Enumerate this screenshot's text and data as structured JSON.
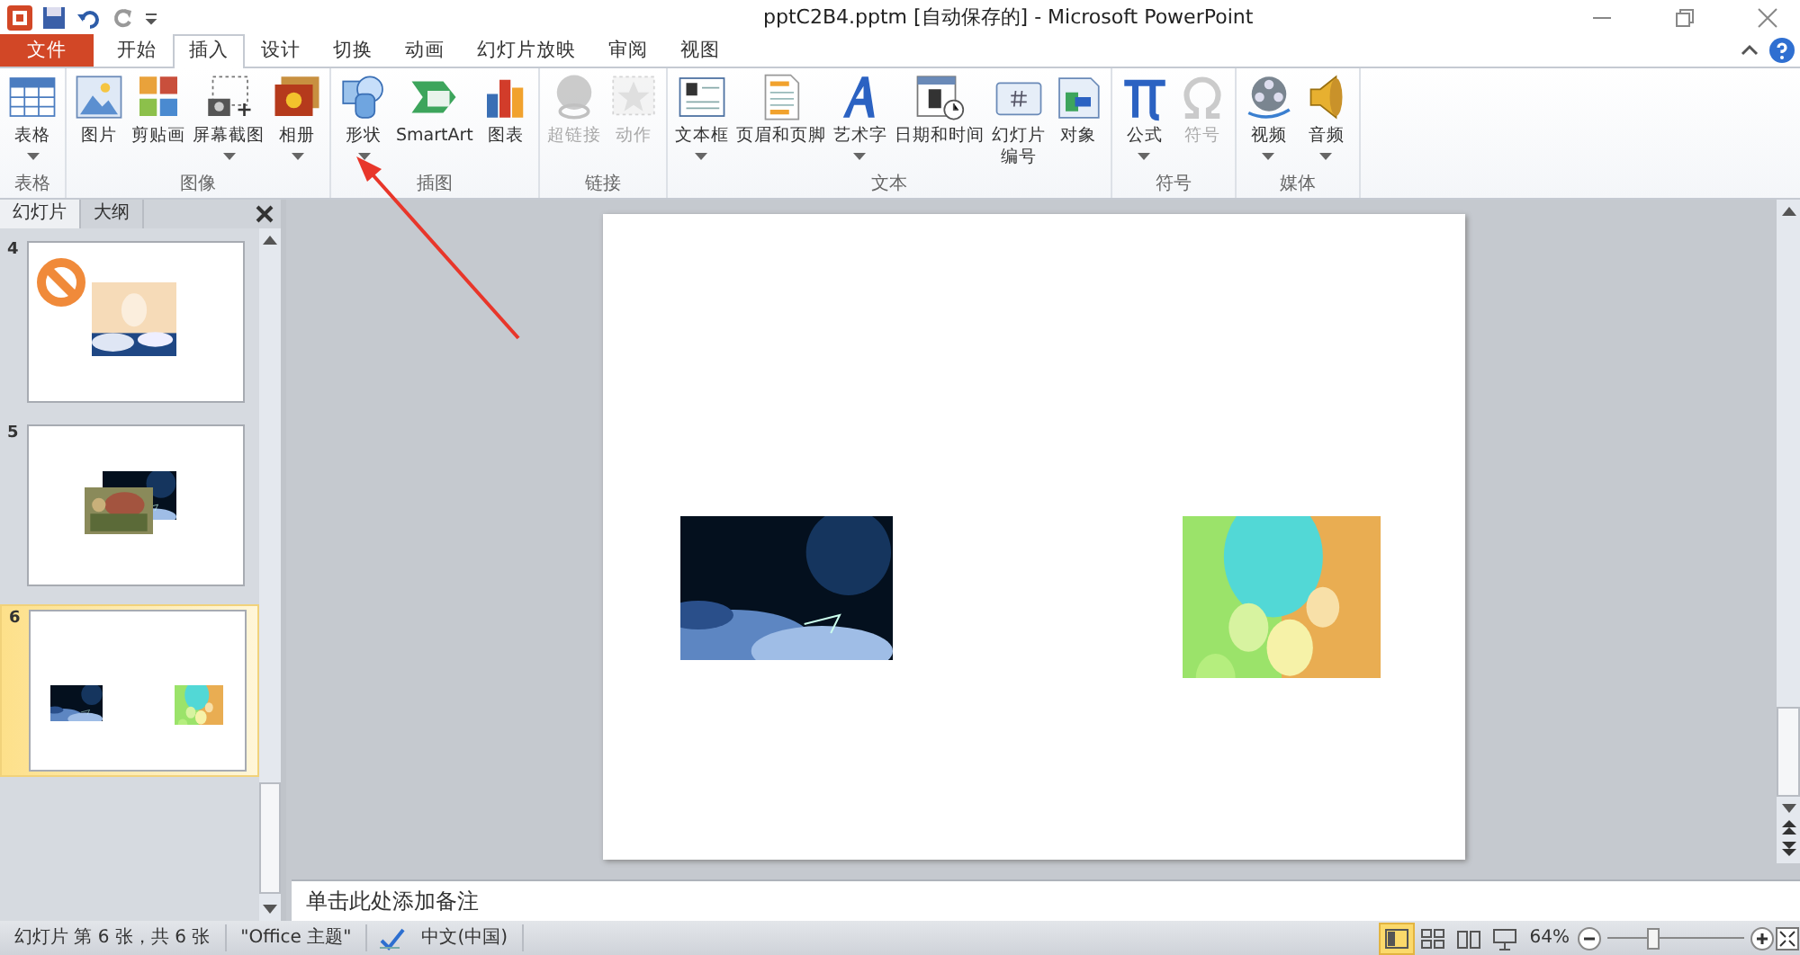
{
  "window": {
    "title": "pptC2B4.pptm [自动保存的] - Microsoft PowerPoint"
  },
  "tabs": [
    {
      "label": "文件",
      "kind": "file",
      "selected": false
    },
    {
      "label": "开始",
      "kind": "tab",
      "selected": false
    },
    {
      "label": "插入",
      "kind": "tab",
      "selected": true
    },
    {
      "label": "设计",
      "kind": "tab",
      "selected": false
    },
    {
      "label": "切换",
      "kind": "tab",
      "selected": false
    },
    {
      "label": "动画",
      "kind": "tab",
      "selected": false
    },
    {
      "label": "幻灯片放映",
      "kind": "tab",
      "selected": false
    },
    {
      "label": "审阅",
      "kind": "tab",
      "selected": false
    },
    {
      "label": "视图",
      "kind": "tab",
      "selected": false
    }
  ],
  "ribbon_groups": [
    {
      "label": "表格",
      "buttons": [
        {
          "label": "表格",
          "kind": "table",
          "dropdown": true,
          "disabled": false
        }
      ]
    },
    {
      "label": "图像",
      "buttons": [
        {
          "label": "图片",
          "kind": "picture",
          "dropdown": false,
          "disabled": false
        },
        {
          "label": "剪贴画",
          "kind": "clipart",
          "dropdown": false,
          "disabled": false
        },
        {
          "label": "屏幕截图",
          "kind": "screenshot",
          "dropdown": true,
          "disabled": false
        },
        {
          "label": "相册",
          "kind": "album",
          "dropdown": true,
          "disabled": false
        }
      ]
    },
    {
      "label": "插图",
      "buttons": [
        {
          "label": "形状",
          "kind": "shapes",
          "dropdown": true,
          "disabled": false
        },
        {
          "label": "SmartArt",
          "kind": "smartart",
          "dropdown": false,
          "disabled": false
        },
        {
          "label": "图表",
          "kind": "chart",
          "dropdown": false,
          "disabled": false
        }
      ]
    },
    {
      "label": "链接",
      "buttons": [
        {
          "label": "超链接",
          "kind": "globe",
          "dropdown": false,
          "disabled": true
        },
        {
          "label": "动作",
          "kind": "star",
          "dropdown": false,
          "disabled": true
        }
      ]
    },
    {
      "label": "文本",
      "buttons": [
        {
          "label": "文本框",
          "kind": "textbox",
          "dropdown": true,
          "disabled": false
        },
        {
          "label": "页眉和页脚",
          "kind": "page",
          "dropdown": false,
          "disabled": false
        },
        {
          "label": "艺术字",
          "kind": "wordart",
          "dropdown": true,
          "disabled": false
        },
        {
          "label": "日期和时间",
          "kind": "calendar",
          "dropdown": false,
          "disabled": false
        },
        {
          "label": "幻灯片编号",
          "kind": "slidenum",
          "dropdown": false,
          "disabled": false
        },
        {
          "label": "对象",
          "kind": "object",
          "dropdown": false,
          "disabled": false
        }
      ]
    },
    {
      "label": "符号",
      "buttons": [
        {
          "label": "公式",
          "kind": "pi",
          "dropdown": true,
          "disabled": false
        },
        {
          "label": "符号",
          "kind": "omega",
          "dropdown": false,
          "disabled": true
        }
      ]
    },
    {
      "label": "媒体",
      "buttons": [
        {
          "label": "视频",
          "kind": "film",
          "dropdown": true,
          "disabled": false
        },
        {
          "label": "音频",
          "kind": "speaker",
          "dropdown": true,
          "disabled": false
        }
      ]
    }
  ],
  "slides_pane": {
    "tabs": [
      {
        "label": "幻灯片",
        "selected": true
      },
      {
        "label": "大纲",
        "selected": false
      }
    ],
    "slides": [
      {
        "number": "4",
        "selected": false,
        "kind": "cover"
      },
      {
        "number": "5",
        "selected": false,
        "kind": "overlap"
      },
      {
        "number": "6",
        "selected": true,
        "kind": "pair"
      }
    ]
  },
  "notes": {
    "placeholder": "单击此处添加备注"
  },
  "status_bar": {
    "items": [
      "幻灯片 第 6 张，共 6 张",
      "\"Office 主题\"",
      "中文(中国)"
    ],
    "views": [
      {
        "kind": "normal",
        "selected": true
      },
      {
        "kind": "sorter",
        "selected": false
      },
      {
        "kind": "reading",
        "selected": false
      },
      {
        "kind": "show",
        "selected": false
      }
    ],
    "zoom": "64%",
    "zoom_slider": {
      "level": 0.32
    }
  }
}
